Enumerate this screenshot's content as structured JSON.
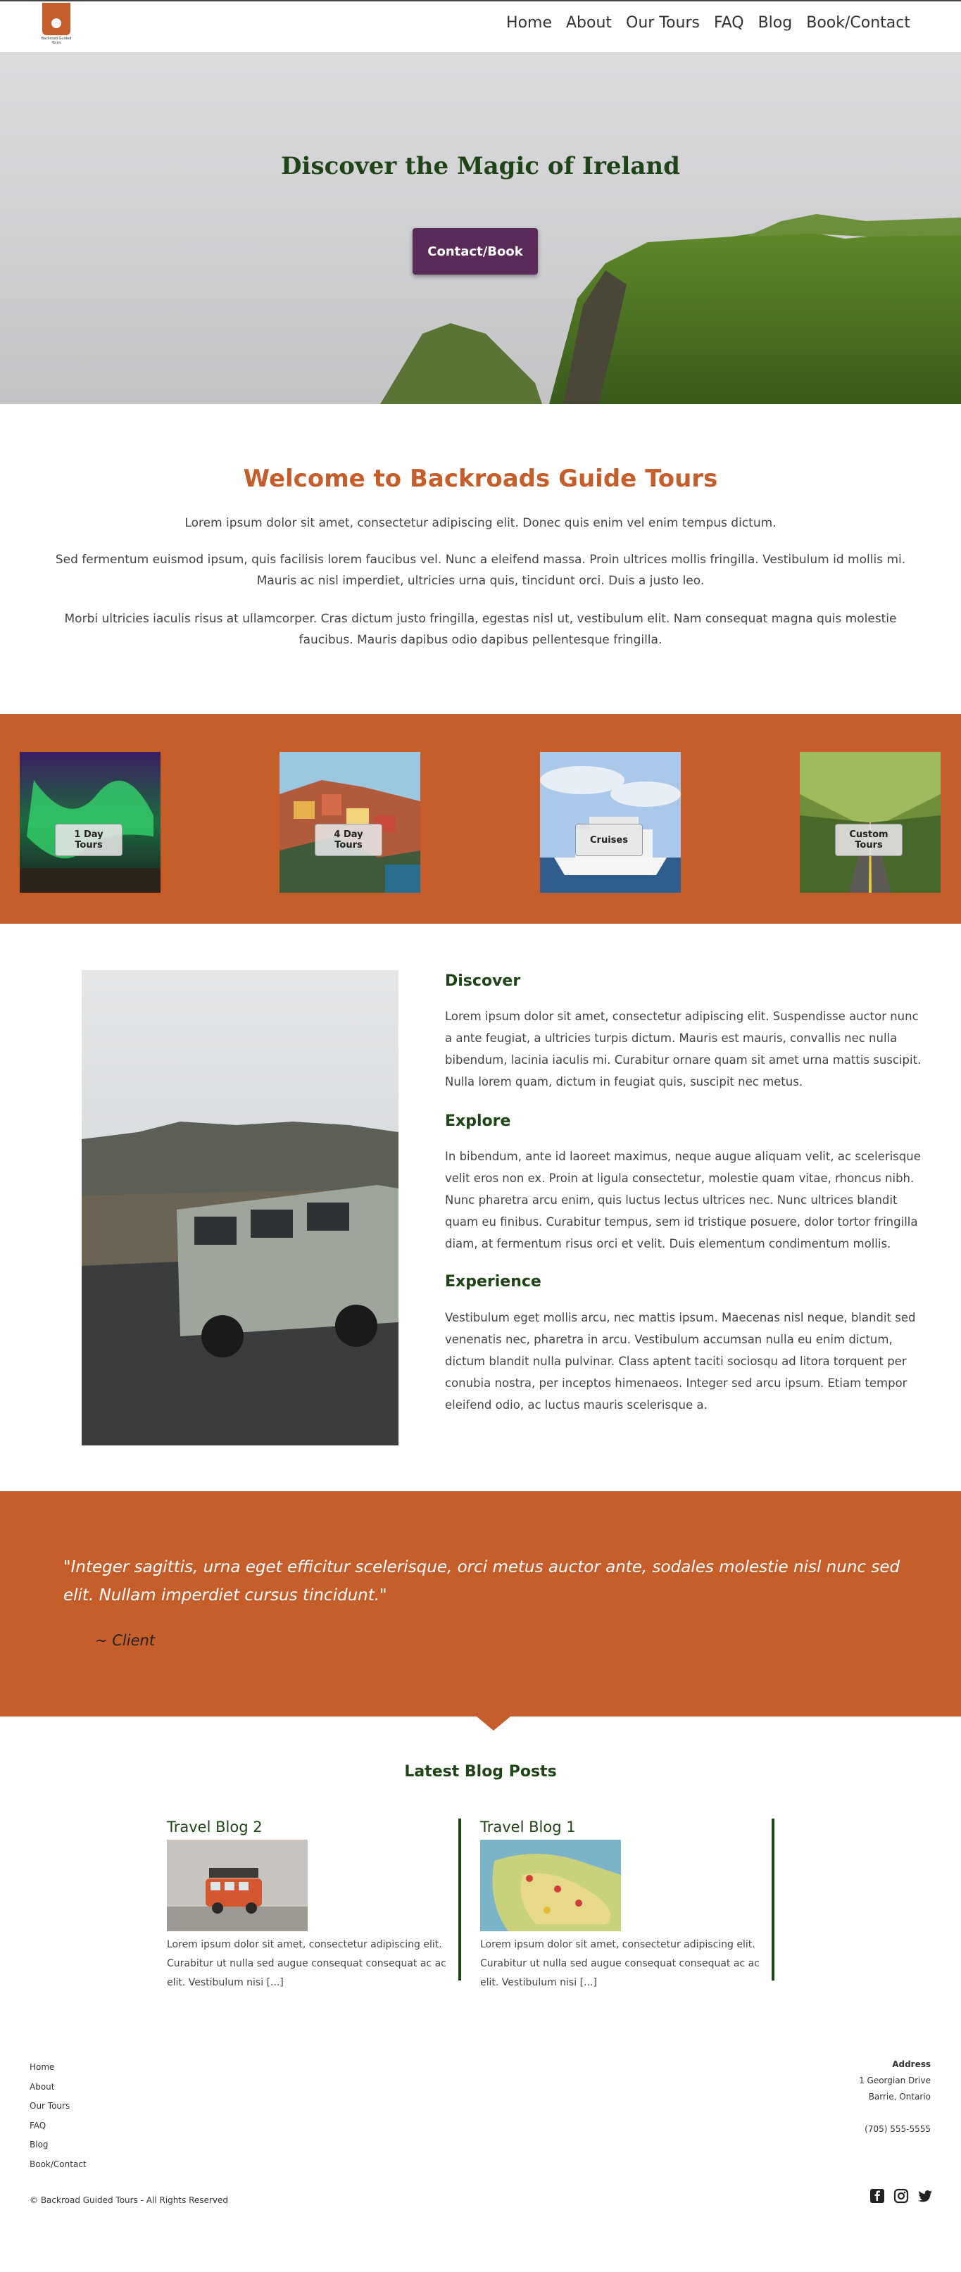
{
  "logo": {
    "text": "Backroad Guided Tours"
  },
  "nav": {
    "items": [
      "Home",
      "About",
      "Our Tours",
      "FAQ",
      "Blog",
      "Book/Contact"
    ]
  },
  "hero": {
    "title": "Discover the Magic of Ireland",
    "button": "Contact/Book"
  },
  "welcome": {
    "title": "Welcome to Backroads Guide Tours",
    "p1": "Lorem ipsum dolor sit amet, consectetur adipiscing elit. Donec quis enim vel enim tempus dictum.",
    "p2": "Sed fermentum euismod ipsum, quis facilisis lorem faucibus vel. Nunc a eleifend massa. Proin ultrices mollis fringilla. Vestibulum id mollis mi. Mauris ac nisl imperdiet, ultricies urna quis, tincidunt orci. Duis a justo leo.",
    "p3": "Morbi ultricies iaculis risus at ullamcorper. Cras dictum justo fringilla, egestas nisl ut, vestibulum elit. Nam consequat magna quis molestie faucibus. Mauris dapibus odio dapibus pellentesque fringilla."
  },
  "tours": [
    {
      "label": "1 Day Tours"
    },
    {
      "label": "4 Day Tours"
    },
    {
      "label": "Cruises"
    },
    {
      "label": "Custom Tours"
    }
  ],
  "features": [
    {
      "heading": "Discover",
      "text": "Lorem ipsum dolor sit amet, consectetur adipiscing elit. Suspendisse auctor nunc a ante feugiat, a ultricies turpis dictum. Mauris est mauris, convallis nec nulla bibendum, lacinia iaculis mi. Curabitur ornare quam sit amet urna mattis suscipit. Nulla lorem quam, dictum in feugiat quis, suscipit nec metus."
    },
    {
      "heading": "Explore",
      "text": "In bibendum, ante id laoreet maximus, neque augue aliquam velit, ac scelerisque velit eros non ex. Proin at ligula consectetur, molestie quam vitae, rhoncus nibh. Nunc pharetra arcu enim, quis luctus lectus ultrices nec. Nunc ultrices blandit quam eu finibus. Curabitur tempus, sem id tristique posuere, dolor tortor fringilla diam, at fermentum risus orci et velit. Duis elementum condimentum mollis."
    },
    {
      "heading": "Experience",
      "text": "Vestibulum eget mollis arcu, nec mattis ipsum. Maecenas nisl neque, blandit sed venenatis nec, pharetra in arcu. Vestibulum accumsan nulla eu enim dictum, dictum blandit nulla pulvinar. Class aptent taciti sociosqu ad litora torquent per conubia nostra, per inceptos himenaeos. Integer sed arcu ipsum. Etiam tempor eleifend odio, ac luctus mauris scelerisque a."
    }
  ],
  "quote": {
    "text": "\"Integer sagittis, urna eget efficitur scelerisque, orci metus auctor ante, sodales molestie nisl nunc sed elit. Nullam imperdiet cursus tincidunt.\"",
    "client": "~ Client"
  },
  "blog": {
    "title": "Latest Blog Posts",
    "posts": [
      {
        "title": "Travel Blog 2",
        "excerpt": "Lorem ipsum dolor sit amet, consectetur adipiscing elit. Curabitur ut nulla sed augue consequat consequat ac ac elit. Vestibulum nisi [...]"
      },
      {
        "title": "Travel Blog 1",
        "excerpt": "Lorem ipsum dolor sit amet, consectetur adipiscing elit. Curabitur ut nulla sed augue consequat consequat ac ac elit. Vestibulum nisi [...]"
      }
    ]
  },
  "footer": {
    "links": [
      "Home",
      "About",
      "Our Tours",
      "FAQ",
      "Blog",
      "Book/Contact"
    ],
    "address_label": "Address",
    "address_line1": "1 Georgian Drive",
    "address_line2": "Barrie, Ontario",
    "phone": "(705) 555-5555",
    "copyright": "© Backroad Guided Tours - All Rights Reserved"
  },
  "colors": {
    "accent": "#c55e2b",
    "heading_green": "#1f4417",
    "button_purple": "#5a2a58"
  },
  "icons": [
    "facebook-icon",
    "instagram-icon",
    "twitter-icon"
  ]
}
